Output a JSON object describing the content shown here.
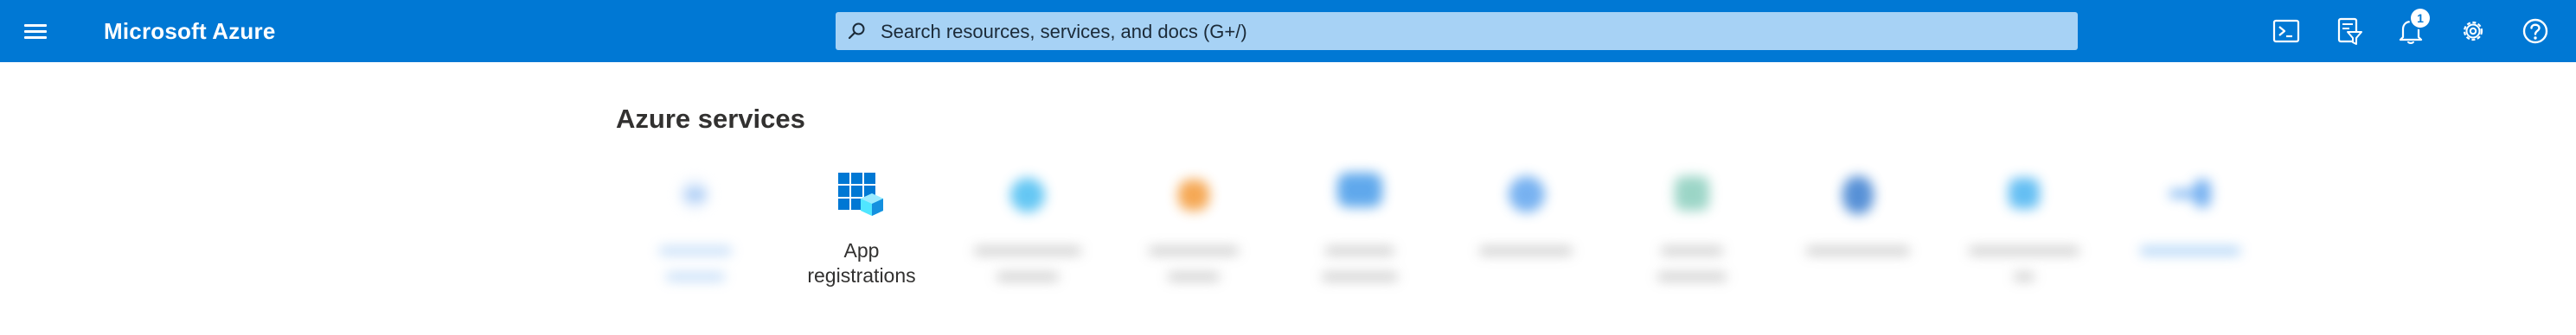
{
  "header": {
    "brand": "Microsoft Azure",
    "menu_icon": "hamburger-menu-icon",
    "search": {
      "placeholder": "Search resources, services, and docs (G+/)",
      "icon": "search-icon"
    },
    "notifications_count": "1",
    "icons": [
      "cloud-shell-icon",
      "directory-filter-icon",
      "notifications-bell-icon",
      "settings-gear-icon",
      "help-icon"
    ]
  },
  "services": {
    "title": "Azure services",
    "visible_item": {
      "label_line1": "App",
      "label_line2": "registrations",
      "icon": "app-registrations-icon"
    }
  },
  "colors": {
    "topbar": "#0078d4",
    "search_bg": "#a7d2f5",
    "text": "#323130"
  }
}
